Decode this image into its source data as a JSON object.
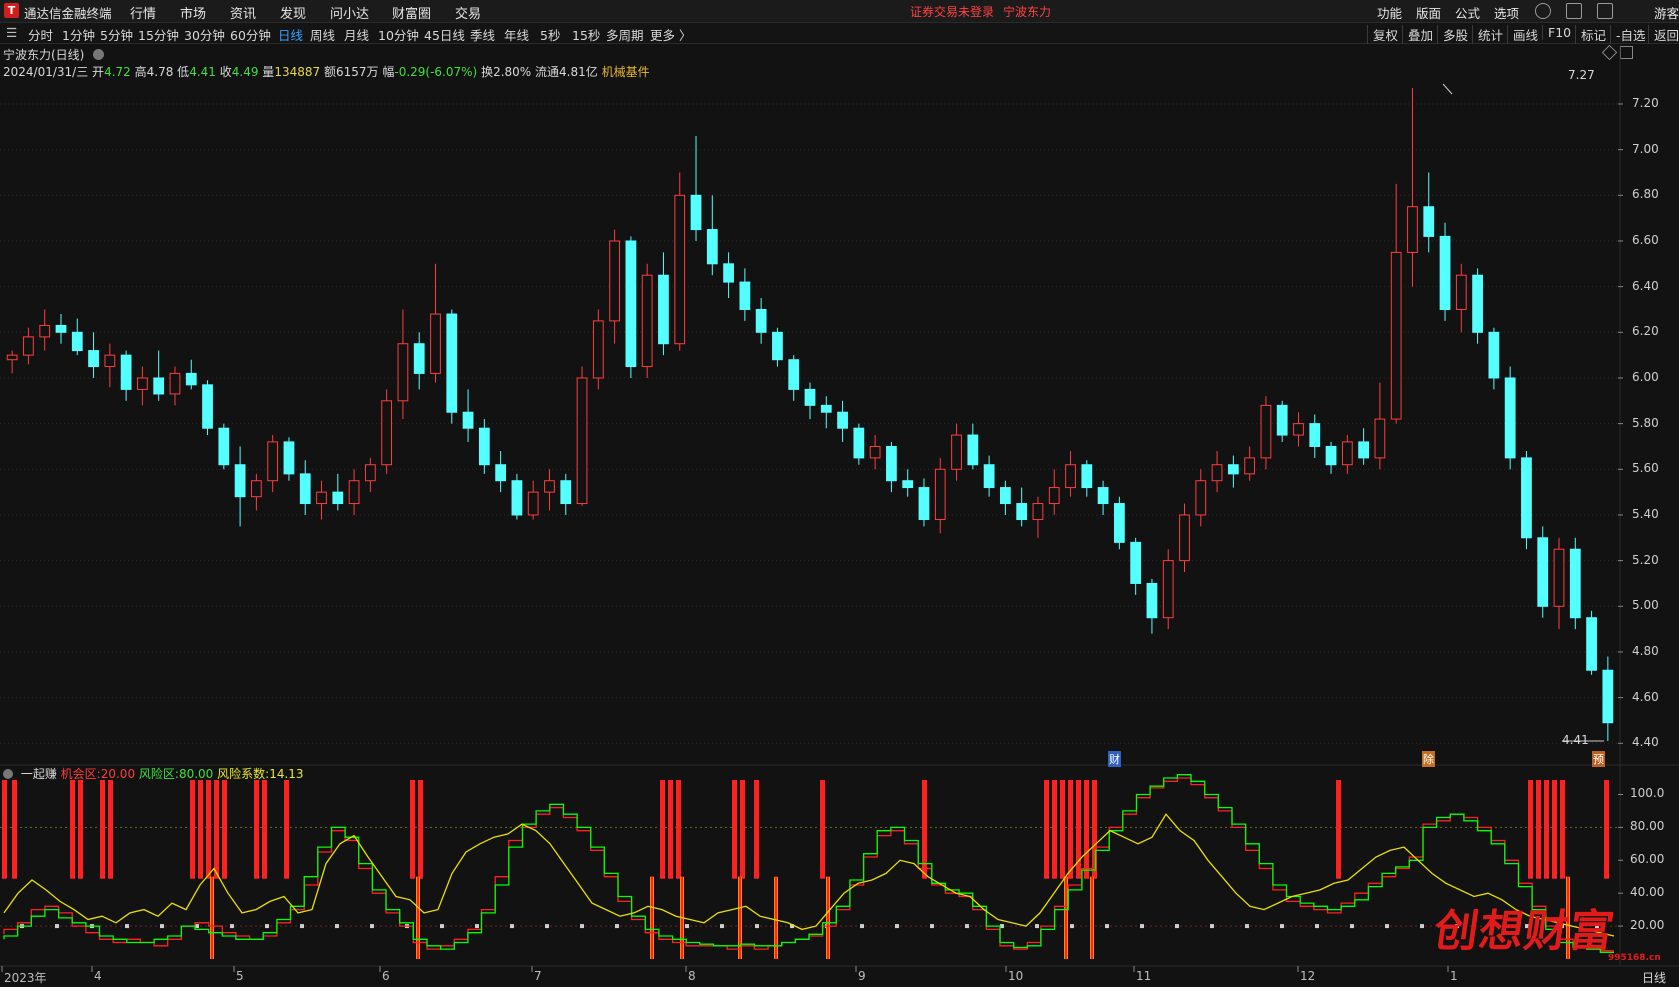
{
  "menubar": {
    "app_title": "通达信金融终端",
    "menus": [
      "行情",
      "市场",
      "资讯",
      "发现",
      "问小达",
      "财富圈",
      "交易"
    ],
    "warning": "证券交易未登录",
    "stock_link": "宁波东力",
    "right_menus": [
      "功能",
      "版面",
      "公式",
      "选项"
    ],
    "user": "游客"
  },
  "toolbar": {
    "periods": [
      "分时",
      "1分钟",
      "5分钟",
      "15分钟",
      "30分钟",
      "60分钟",
      "日线",
      "周线",
      "月线",
      "10分钟",
      "45日线",
      "季线",
      "年线",
      "5秒",
      "15秒",
      "多周期",
      "更多 〉"
    ],
    "active": "日线",
    "right_tools": [
      "复权",
      "叠加",
      "多股",
      "统计",
      "画线",
      "F10",
      "标记",
      "-自选",
      "返回"
    ]
  },
  "main_header": {
    "title": "宁波东力(日线)",
    "date": "2024/01/31/三",
    "open_label": "开",
    "open": "4.72",
    "high_label": "高",
    "high": "4.78",
    "low_label": "低",
    "low": "4.41",
    "close_label": "收",
    "close": "4.49",
    "vol_label": "量",
    "vol": "134887",
    "amt_label": "额",
    "amt": "6157万",
    "chg_label": "幅",
    "chg": "-0.29(-6.07%)",
    "turn_label": "换",
    "turn": "2.80%",
    "float_label": "流通",
    "float": "4.81亿",
    "sector": "机械基件"
  },
  "indicator_header": {
    "name": "一起赚",
    "opp_label": "机会区:",
    "opp": "20.00",
    "risk_label": "风险区:",
    "risk": "80.00",
    "coef_label": "风险系数:",
    "coef": "14.13"
  },
  "markers": {
    "fin": "财",
    "split": "除",
    "pre": "预"
  },
  "watermark": {
    "text": "创想财富",
    "url": "995168.cn"
  },
  "bottom_label": "日线",
  "colors": {
    "up": "#ff3d3d",
    "down": "#54ffff",
    "bg": "#121212",
    "yellow": "#ffff00",
    "green": "#00ff00",
    "red": "#ff2020"
  },
  "chart_data": [
    {
      "type": "candlestick",
      "x_labels": [
        "2023年",
        "4",
        "5",
        "6",
        "7",
        "8",
        "9",
        "10",
        "11",
        "12",
        "1"
      ],
      "ylim": [
        4.41,
        7.27
      ],
      "yticks": [
        "7.20",
        "7.00",
        "6.80",
        "6.60",
        "6.40",
        "6.20",
        "6.00",
        "5.80",
        "5.60",
        "5.40",
        "5.20",
        "5.00",
        "4.80",
        "4.60",
        "4.40"
      ],
      "max_annotation": "7.27",
      "min_annotation": "4.41",
      "ohlc": [
        [
          6.08,
          6.12,
          6.02,
          6.1
        ],
        [
          6.1,
          6.22,
          6.06,
          6.18
        ],
        [
          6.18,
          6.3,
          6.12,
          6.23
        ],
        [
          6.23,
          6.28,
          6.15,
          6.2
        ],
        [
          6.2,
          6.26,
          6.1,
          6.12
        ],
        [
          6.12,
          6.2,
          6.0,
          6.05
        ],
        [
          6.05,
          6.15,
          5.96,
          6.1
        ],
        [
          6.1,
          6.12,
          5.9,
          5.95
        ],
        [
          5.95,
          6.05,
          5.88,
          6.0
        ],
        [
          6.0,
          6.12,
          5.9,
          5.93
        ],
        [
          5.93,
          6.05,
          5.88,
          6.02
        ],
        [
          6.02,
          6.08,
          5.95,
          5.97
        ],
        [
          5.97,
          5.99,
          5.75,
          5.78
        ],
        [
          5.78,
          5.8,
          5.6,
          5.62
        ],
        [
          5.62,
          5.7,
          5.35,
          5.48
        ],
        [
          5.48,
          5.58,
          5.42,
          5.55
        ],
        [
          5.55,
          5.75,
          5.5,
          5.72
        ],
        [
          5.72,
          5.74,
          5.55,
          5.58
        ],
        [
          5.58,
          5.64,
          5.4,
          5.45
        ],
        [
          5.45,
          5.55,
          5.38,
          5.5
        ],
        [
          5.5,
          5.58,
          5.42,
          5.45
        ],
        [
          5.45,
          5.6,
          5.4,
          5.55
        ],
        [
          5.55,
          5.65,
          5.5,
          5.62
        ],
        [
          5.62,
          5.95,
          5.58,
          5.9
        ],
        [
          5.9,
          6.3,
          5.82,
          6.15
        ],
        [
          6.15,
          6.2,
          5.95,
          6.02
        ],
        [
          6.02,
          6.5,
          5.98,
          6.28
        ],
        [
          6.28,
          6.3,
          5.8,
          5.85
        ],
        [
          5.85,
          5.95,
          5.72,
          5.78
        ],
        [
          5.78,
          5.82,
          5.58,
          5.62
        ],
        [
          5.62,
          5.68,
          5.5,
          5.55
        ],
        [
          5.55,
          5.58,
          5.38,
          5.4
        ],
        [
          5.4,
          5.55,
          5.38,
          5.5
        ],
        [
          5.5,
          5.6,
          5.42,
          5.55
        ],
        [
          5.55,
          5.58,
          5.4,
          5.45
        ],
        [
          5.45,
          6.05,
          5.44,
          6.0
        ],
        [
          6.0,
          6.3,
          5.95,
          6.25
        ],
        [
          6.25,
          6.65,
          6.15,
          6.6
        ],
        [
          6.6,
          6.62,
          6.0,
          6.05
        ],
        [
          6.05,
          6.5,
          6.0,
          6.45
        ],
        [
          6.45,
          6.55,
          6.1,
          6.15
        ],
        [
          6.15,
          6.9,
          6.12,
          6.8
        ],
        [
          6.8,
          7.06,
          6.6,
          6.65
        ],
        [
          6.65,
          6.8,
          6.45,
          6.5
        ],
        [
          6.5,
          6.55,
          6.35,
          6.42
        ],
        [
          6.42,
          6.48,
          6.25,
          6.3
        ],
        [
          6.3,
          6.35,
          6.15,
          6.2
        ],
        [
          6.2,
          6.22,
          6.05,
          6.08
        ],
        [
          6.08,
          6.1,
          5.9,
          5.95
        ],
        [
          5.95,
          5.98,
          5.82,
          5.88
        ],
        [
          5.88,
          5.92,
          5.78,
          5.85
        ],
        [
          5.85,
          5.9,
          5.72,
          5.78
        ],
        [
          5.78,
          5.8,
          5.62,
          5.65
        ],
        [
          5.65,
          5.75,
          5.6,
          5.7
        ],
        [
          5.7,
          5.72,
          5.5,
          5.55
        ],
        [
          5.55,
          5.6,
          5.48,
          5.52
        ],
        [
          5.52,
          5.56,
          5.35,
          5.38
        ],
        [
          5.38,
          5.65,
          5.32,
          5.6
        ],
        [
          5.6,
          5.8,
          5.55,
          5.75
        ],
        [
          5.75,
          5.8,
          5.6,
          5.62
        ],
        [
          5.62,
          5.66,
          5.48,
          5.52
        ],
        [
          5.52,
          5.55,
          5.4,
          5.45
        ],
        [
          5.45,
          5.52,
          5.35,
          5.38
        ],
        [
          5.38,
          5.48,
          5.3,
          5.45
        ],
        [
          5.45,
          5.6,
          5.4,
          5.52
        ],
        [
          5.52,
          5.68,
          5.48,
          5.62
        ],
        [
          5.62,
          5.64,
          5.48,
          5.52
        ],
        [
          5.52,
          5.55,
          5.4,
          5.45
        ],
        [
          5.45,
          5.48,
          5.25,
          5.28
        ],
        [
          5.28,
          5.3,
          5.05,
          5.1
        ],
        [
          5.1,
          5.12,
          4.88,
          4.95
        ],
        [
          4.95,
          5.25,
          4.9,
          5.2
        ],
        [
          5.2,
          5.45,
          5.15,
          5.4
        ],
        [
          5.4,
          5.6,
          5.35,
          5.55
        ],
        [
          5.55,
          5.68,
          5.5,
          5.62
        ],
        [
          5.62,
          5.66,
          5.52,
          5.58
        ],
        [
          5.58,
          5.7,
          5.55,
          5.65
        ],
        [
          5.65,
          5.92,
          5.6,
          5.88
        ],
        [
          5.88,
          5.9,
          5.72,
          5.75
        ],
        [
          5.75,
          5.85,
          5.7,
          5.8
        ],
        [
          5.8,
          5.84,
          5.65,
          5.7
        ],
        [
          5.7,
          5.72,
          5.58,
          5.62
        ],
        [
          5.62,
          5.75,
          5.58,
          5.72
        ],
        [
          5.72,
          5.78,
          5.62,
          5.65
        ],
        [
          5.65,
          5.98,
          5.6,
          5.82
        ],
        [
          5.82,
          6.85,
          5.8,
          6.55
        ],
        [
          6.55,
          7.27,
          6.4,
          6.75
        ],
        [
          6.75,
          6.9,
          6.55,
          6.62
        ],
        [
          6.62,
          6.68,
          6.25,
          6.3
        ],
        [
          6.3,
          6.5,
          6.2,
          6.45
        ],
        [
          6.45,
          6.48,
          6.15,
          6.2
        ],
        [
          6.2,
          6.22,
          5.95,
          6.0
        ],
        [
          6.0,
          6.05,
          5.6,
          5.65
        ],
        [
          5.65,
          5.68,
          5.25,
          5.3
        ],
        [
          5.3,
          5.35,
          4.95,
          5.0
        ],
        [
          5.0,
          5.3,
          4.9,
          5.25
        ],
        [
          5.25,
          5.3,
          4.9,
          4.95
        ],
        [
          4.95,
          4.98,
          4.7,
          4.72
        ],
        [
          4.72,
          4.78,
          4.41,
          4.49
        ]
      ]
    },
    {
      "type": "line",
      "title": "一起赚",
      "ylim": [
        0,
        110
      ],
      "yticks": [
        "100.0",
        "80.00",
        "60.00",
        "40.00",
        "20.00"
      ],
      "series": [
        {
          "name": "机会区",
          "color": "red",
          "values": [
            15,
            18,
            22,
            30,
            32,
            28,
            20,
            16,
            12,
            10,
            12,
            10,
            8,
            12,
            20,
            22,
            20,
            16,
            14,
            12,
            14,
            22,
            30,
            45,
            65,
            78,
            72,
            55,
            40,
            28,
            20,
            10,
            6,
            8,
            12,
            18,
            30,
            50,
            72,
            80,
            88,
            92,
            86,
            78,
            66,
            50,
            35,
            24,
            16,
            12,
            10,
            8,
            8,
            8,
            6,
            8,
            6,
            8,
            10,
            12,
            14,
            20,
            30,
            45,
            62,
            75,
            78,
            70,
            55,
            45,
            40,
            38,
            30,
            18,
            8,
            6,
            10,
            20,
            32,
            45,
            55,
            68,
            80,
            88,
            98,
            104,
            108,
            110,
            106,
            98,
            90,
            80,
            66,
            55,
            42,
            35,
            32,
            30,
            28,
            34,
            40,
            46,
            50,
            55,
            62,
            82,
            84,
            88,
            86,
            80,
            72,
            60,
            46,
            32,
            20,
            12,
            8,
            6,
            5
          ]
        },
        {
          "name": "风险区",
          "color": "green",
          "values": [
            12,
            14,
            20,
            26,
            30,
            25,
            22,
            20,
            14,
            12,
            10,
            10,
            12,
            14,
            20,
            18,
            16,
            14,
            12,
            12,
            16,
            24,
            32,
            50,
            68,
            80,
            74,
            58,
            42,
            30,
            22,
            12,
            8,
            6,
            10,
            16,
            28,
            45,
            68,
            82,
            90,
            94,
            88,
            80,
            68,
            52,
            38,
            26,
            18,
            14,
            12,
            10,
            9,
            8,
            8,
            9,
            8,
            8,
            10,
            12,
            15,
            22,
            32,
            48,
            64,
            78,
            80,
            72,
            58,
            46,
            42,
            40,
            32,
            20,
            10,
            7,
            8,
            18,
            30,
            42,
            54,
            66,
            78,
            90,
            100,
            105,
            110,
            112,
            108,
            100,
            92,
            82,
            70,
            58,
            45,
            38,
            34,
            32,
            30,
            32,
            36,
            44,
            52,
            56,
            60,
            80,
            86,
            88,
            84,
            78,
            70,
            58,
            44,
            30,
            18,
            10,
            7,
            6,
            4
          ]
        },
        {
          "name": "风险系数",
          "color": "yellow",
          "values": [
            28,
            40,
            48,
            42,
            35,
            30,
            24,
            26,
            22,
            28,
            30,
            26,
            34,
            30,
            45,
            55,
            40,
            28,
            30,
            35,
            38,
            28,
            30,
            58,
            70,
            75,
            62,
            50,
            38,
            36,
            28,
            30,
            52,
            65,
            70,
            74,
            76,
            82,
            78,
            70,
            58,
            46,
            34,
            30,
            26,
            28,
            32,
            30,
            26,
            24,
            22,
            28,
            30,
            32,
            26,
            24,
            22,
            18,
            20,
            30,
            40,
            46,
            48,
            52,
            60,
            58,
            50,
            45,
            40,
            38,
            30,
            24,
            22,
            20,
            28,
            40,
            52,
            62,
            70,
            78,
            74,
            70,
            74,
            88,
            78,
            72,
            60,
            50,
            40,
            32,
            30,
            34,
            38,
            40,
            42,
            46,
            48,
            55,
            62,
            66,
            68,
            60,
            52,
            46,
            42,
            38,
            40,
            36,
            30,
            26,
            24,
            22,
            20,
            18,
            16,
            14
          ]
        }
      ]
    }
  ]
}
